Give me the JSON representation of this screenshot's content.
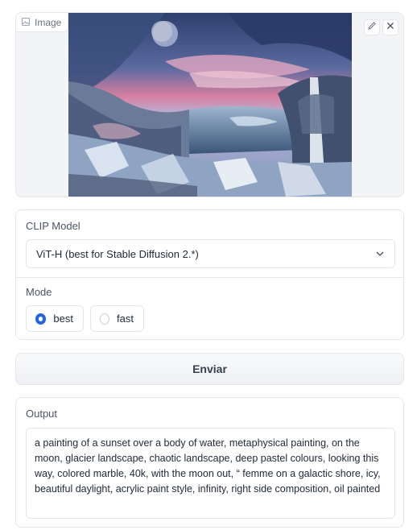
{
  "image_panel": {
    "label": "Image",
    "icon": "image-icon",
    "actions": [
      "edit-icon",
      "close-icon"
    ]
  },
  "clip_model": {
    "label": "CLIP Model",
    "selected": "ViT-H (best for Stable Diffusion 2.*)"
  },
  "mode": {
    "label": "Mode",
    "options": [
      {
        "label": "best",
        "selected": true
      },
      {
        "label": "fast",
        "selected": false
      }
    ]
  },
  "submit_label": "Enviar",
  "output": {
    "label": "Output",
    "value": "a painting of a sunset over a body of water, metaphysical painting, on the moon, glacier landscape, chaotic landscape, deep pastel colours, looking this way, colored marble, 40k, with the moon out, “ femme on a galactic shore, icy, beautiful daylight, acrylic paint style, infinity, right side composition, oil painted"
  },
  "colors": {
    "accent": "#2563eb",
    "border": "#e5e7eb",
    "panel_bg": "#f3f4f6"
  }
}
